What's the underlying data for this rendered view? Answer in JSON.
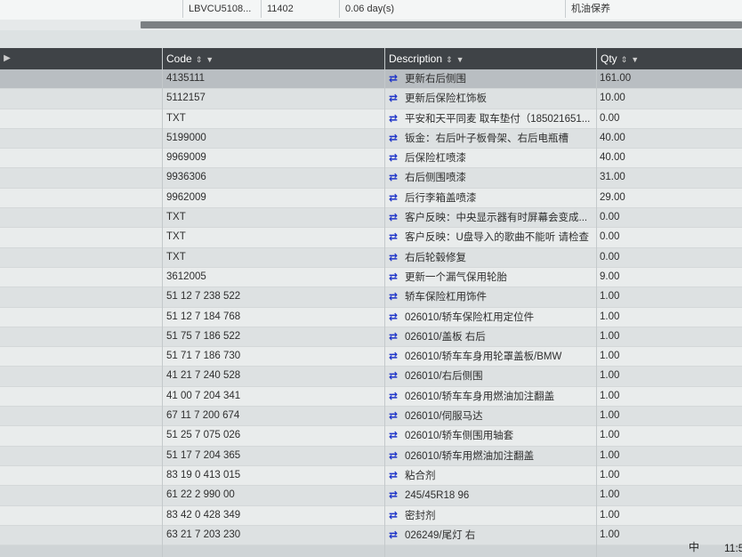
{
  "top_row": {
    "vin": "LBVCU5108...",
    "number": "11402",
    "duration": "0.06 day(s)",
    "service": "机油保养"
  },
  "columns": {
    "code": "Code",
    "description": "Description",
    "qty": "Qty"
  },
  "rows": [
    {
      "code": "4135111",
      "description": "更新右后侧围",
      "qty": "161.00"
    },
    {
      "code": "5112157",
      "description": "更新后保险杠饰板",
      "qty": "10.00"
    },
    {
      "code": "TXT",
      "description": "平安和天平同麦 取车垫付（185021651...",
      "qty": "0.00"
    },
    {
      "code": "5199000",
      "description": "钣金：右后叶子板骨架、右后电瓶槽",
      "qty": "40.00"
    },
    {
      "code": "9969009",
      "description": "后保险杠喷漆",
      "qty": "40.00"
    },
    {
      "code": "9936306",
      "description": "右后侧围喷漆",
      "qty": "31.00"
    },
    {
      "code": "9962009",
      "description": "后行李箱盖喷漆",
      "qty": "29.00"
    },
    {
      "code": "TXT",
      "description": "客户反映：中央显示器有时屏幕会变成...",
      "qty": "0.00"
    },
    {
      "code": "TXT",
      "description": "客户反映：U盘导入的歌曲不能听 请检查",
      "qty": "0.00"
    },
    {
      "code": "TXT",
      "description": "右后轮毂修复",
      "qty": "0.00"
    },
    {
      "code": "3612005",
      "description": "更新一个漏气保用轮胎",
      "qty": "9.00"
    },
    {
      "code": "51 12 7 238 522",
      "description": "轿车保险杠用饰件",
      "qty": "1.00"
    },
    {
      "code": "51 12 7 184 768",
      "description": "026010/轿车保险杠用定位件",
      "qty": "1.00"
    },
    {
      "code": "51 75 7 186 522",
      "description": "026010/盖板 右后",
      "qty": "1.00"
    },
    {
      "code": "51 71 7 186 730",
      "description": "026010/轿车车身用轮罩盖板/BMW",
      "qty": "1.00"
    },
    {
      "code": "41 21 7 240 528",
      "description": "026010/右后侧围",
      "qty": "1.00"
    },
    {
      "code": "41 00 7 204 341",
      "description": "026010/轿车车身用燃油加注翻盖",
      "qty": "1.00"
    },
    {
      "code": "67 11 7 200 674",
      "description": "026010/伺服马达",
      "qty": "1.00"
    },
    {
      "code": "51 25 7 075 026",
      "description": "026010/轿车侧围用轴套",
      "qty": "1.00"
    },
    {
      "code": "51 17 7 204 365",
      "description": "026010/轿车用燃油加注翻盖",
      "qty": "1.00"
    },
    {
      "code": "83 19 0 413 015",
      "description": "粘合剂",
      "qty": "1.00"
    },
    {
      "code": "61 22 2 990 00",
      "description": "245/45R18 96",
      "qty": "1.00"
    },
    {
      "code": "83 42 0 428 349",
      "description": "密封剂",
      "qty": "1.00"
    },
    {
      "code": "63 21 7 203 230",
      "description": "026249/尾灯 右",
      "qty": "1.00"
    }
  ],
  "tray": {
    "ime": "中",
    "time": "11:5"
  },
  "icons": {
    "sort": "sort-icon",
    "filter": "filter-icon",
    "swap": "swap-arrows-icon"
  },
  "colors": {
    "header_bg": "#3f4347",
    "swap_icon": "#1f35c9"
  }
}
